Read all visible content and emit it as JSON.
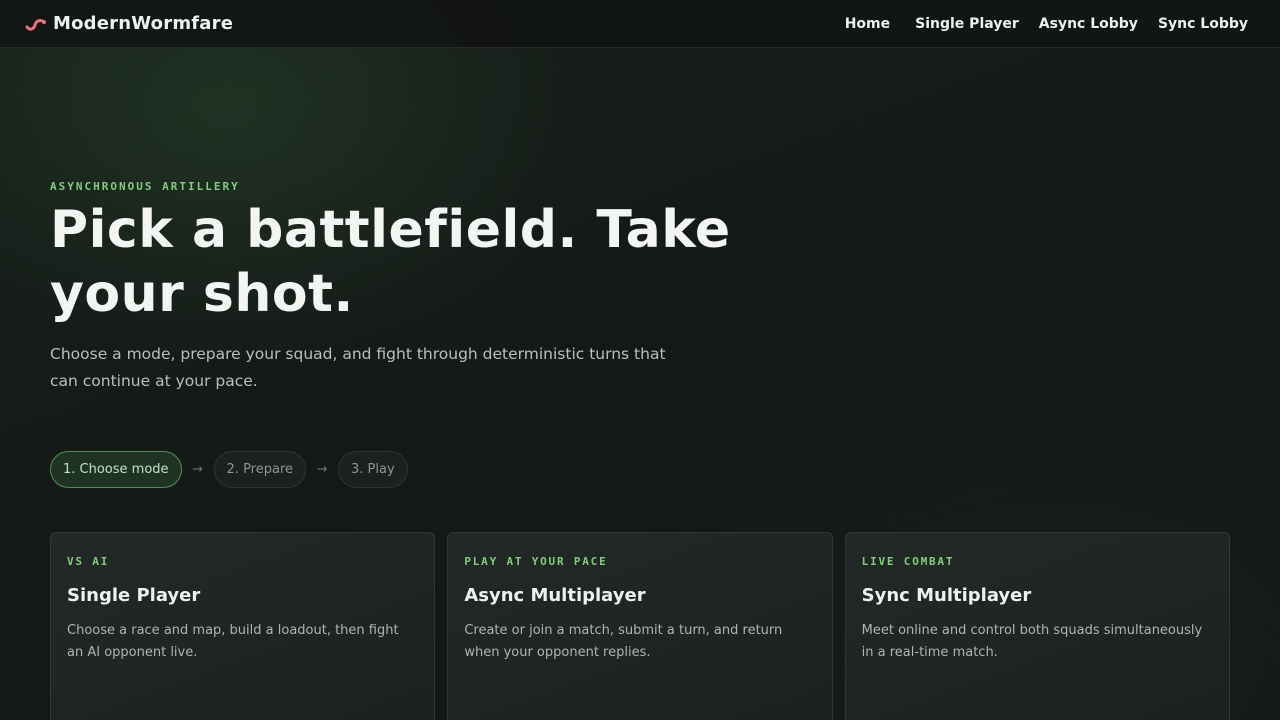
{
  "header": {
    "brand": "ModernWormfare",
    "brand_icon": "worm-icon",
    "nav": {
      "home": "Home",
      "single_player": "Single Player",
      "async_lobby": "Async Lobby",
      "sync_lobby": "Sync Lobby"
    }
  },
  "hero": {
    "eyebrow": "ASYNCHRONOUS ARTILLERY",
    "headline": "Pick a battlefield. Take your shot.",
    "lead": "Choose a mode, prepare your squad, and fight through deterministic turns that can continue at your pace."
  },
  "steps": {
    "items": [
      "1. Choose mode",
      "2. Prepare",
      "3. Play"
    ],
    "arrow": "→",
    "active_index": 0
  },
  "cards": [
    {
      "tag": "VS AI",
      "title": "Single Player",
      "description": "Choose a race and map, build a loadout, then fight an AI opponent live."
    },
    {
      "tag": "PLAY AT YOUR PACE",
      "title": "Async Multiplayer",
      "description": "Create or join a match, submit a turn, and return when your opponent replies."
    },
    {
      "tag": "LIVE COMBAT",
      "title": "Sync Multiplayer",
      "description": "Meet online and control both squads simultaneously in a real-time match."
    }
  ],
  "colors": {
    "accent": "#7fcf7a",
    "brand_icon": "#e8757e",
    "background": "#141816"
  }
}
